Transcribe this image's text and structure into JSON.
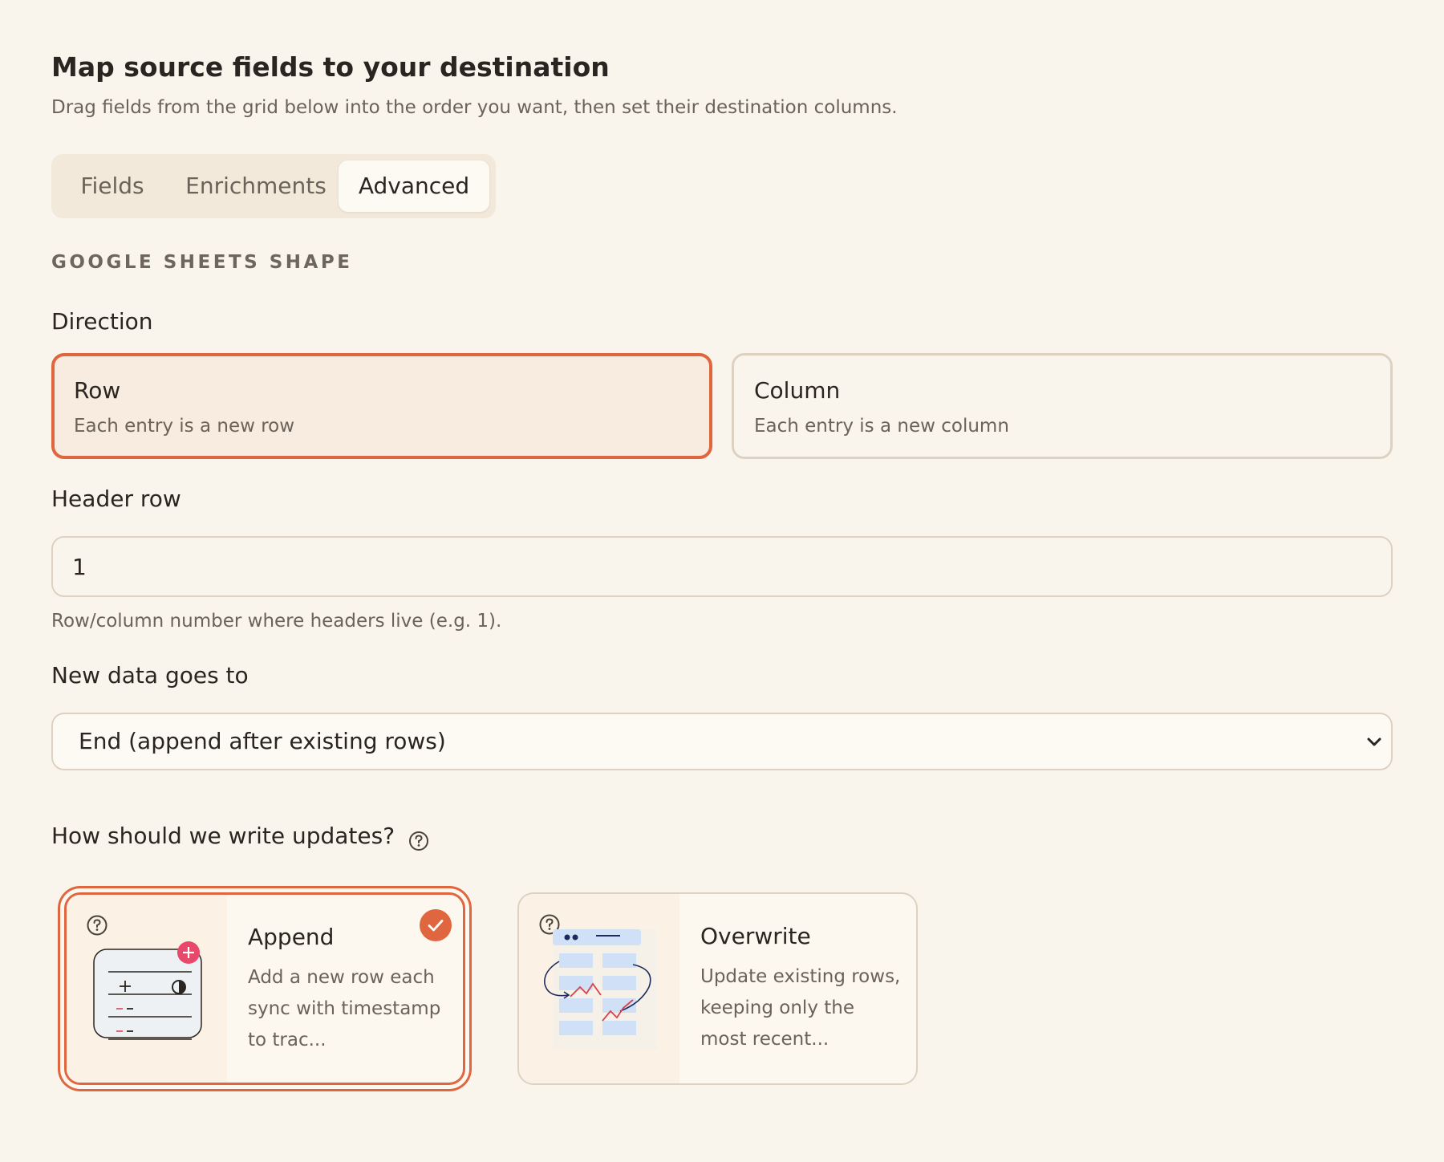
{
  "header": {
    "title": "Map source fields to your destination",
    "subtitle": "Drag fields from the grid below into the order you want, then set their destination columns."
  },
  "tabs": [
    {
      "label": "Fields",
      "active": false
    },
    {
      "label": "Enrichments",
      "active": false
    },
    {
      "label": "Advanced",
      "active": true
    }
  ],
  "section": {
    "label": "GOOGLE SHEETS SHAPE"
  },
  "direction": {
    "label": "Direction",
    "options": [
      {
        "title": "Row",
        "description": "Each entry is a new row",
        "selected": true
      },
      {
        "title": "Column",
        "description": "Each entry is a new column",
        "selected": false
      }
    ]
  },
  "header_row": {
    "label": "Header row",
    "value": "1",
    "hint": "Row/column number where headers live (e.g. 1)."
  },
  "new_data": {
    "label": "New data goes to",
    "selected": "End (append after existing rows)"
  },
  "write_mode": {
    "label": "How should we write updates?",
    "options": [
      {
        "title": "Append",
        "description": "Add a new row each sync with timestamp to trac...",
        "selected": true
      },
      {
        "title": "Overwrite",
        "description": "Update existing rows, keeping only the most recent...",
        "selected": false
      }
    ]
  },
  "colors": {
    "accent": "#e0663f",
    "background": "#faf5ec",
    "border": "#ddd2c2",
    "badge_pink": "#e8486a",
    "illustration_blue": "#cfe0f7"
  },
  "icons": {
    "help": "question-circle-icon",
    "check": "check-circle-icon",
    "dropdown": "chevron-down-icon",
    "append": "append-rows-illustration",
    "overwrite": "overwrite-rows-illustration"
  }
}
